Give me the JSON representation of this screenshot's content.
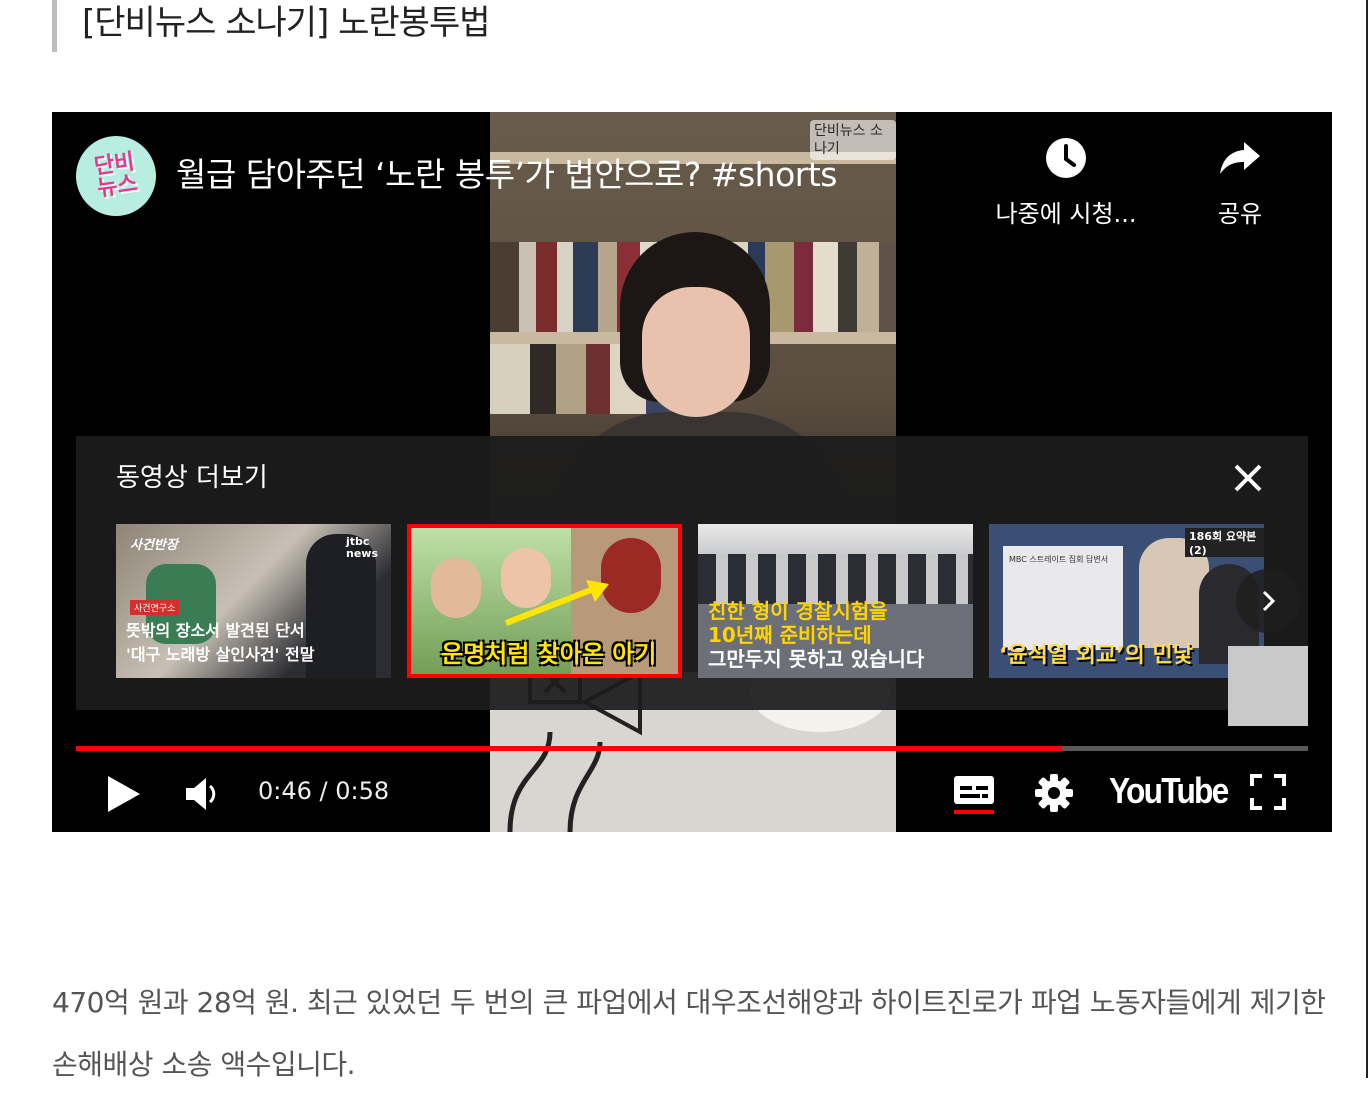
{
  "page": {
    "heading": "[단비뉴스 소나기] 노란봉투법",
    "article_text": "470억 원과 28억 원. 최근 있었던 두 번의 큰 파업에서 대우조선해양과 하이트진로가 파업 노동자들에게 제기한 손해배상 소송 액수입니다."
  },
  "player": {
    "channel_logo_text": "단비 뉴스",
    "video_title": "월급 담아주던 ‘노란 봉투’가 법안으로? #shorts",
    "corner_label": "단비뉴스 소나기",
    "watch_later_label": "나중에 시청...",
    "share_label": "공유",
    "more_videos_title": "동영상 더보기",
    "thumbnails": [
      {
        "tag_top": "사건반장",
        "tag_small": "사건연구소",
        "brand": "jtbc news",
        "caption_1": "뜻밖의 장소서 발견된 단서",
        "caption_2": "'대구 노래방 살인사건' 전말"
      },
      {
        "caption_1": "운명처럼 찾아온 아기"
      },
      {
        "caption_1": "친한 형이 경찰시험을",
        "caption_2": "10년째 준비하는데",
        "caption_3": "그만두지 못하고 있습니다"
      },
      {
        "tag_top": "186회 요약본(2)",
        "doc_label": "MBC 스트레이트 집회 답변서",
        "caption_1": "‘윤석열 외교’의 민낯"
      }
    ],
    "progress": 0.8,
    "time_display": "0:46 / 0:58",
    "brand_text": "YouTube",
    "colors": {
      "progress": "#ff0000",
      "logo_bg": "#b8eee1",
      "logo_text": "#e43a8c"
    }
  },
  "icons": [
    "clock-icon",
    "share-icon",
    "close-icon",
    "chevron-right-icon",
    "play-icon",
    "volume-icon",
    "subtitles-icon",
    "settings-icon",
    "fullscreen-icon"
  ]
}
